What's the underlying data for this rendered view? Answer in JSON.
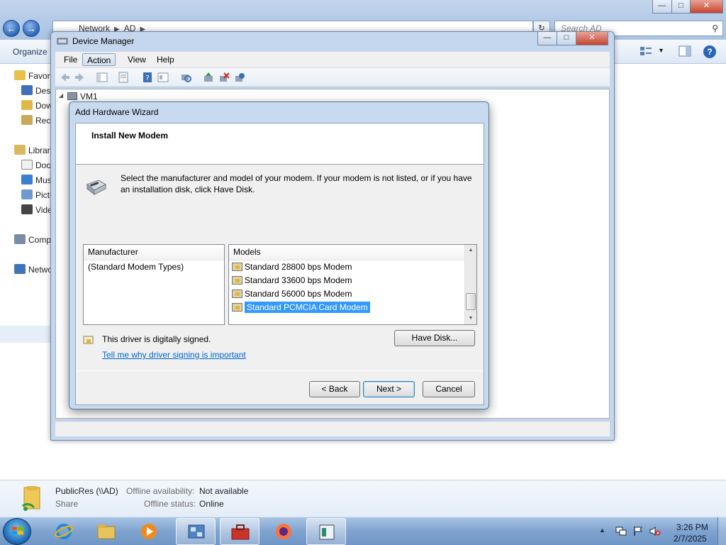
{
  "explorer": {
    "address": [
      "Network",
      "AD"
    ],
    "search_placeholder": "Search AD",
    "organize_label": "Organize",
    "nav": {
      "favorites": "Favorites",
      "desktop": "Desktop",
      "downloads": "Downloads",
      "recent": "Recent Places",
      "libraries": "Libraries",
      "documents": "Documents",
      "music": "Music",
      "pictures": "Pictures",
      "videos": "Videos",
      "computer": "Computer",
      "network": "Network"
    },
    "details": {
      "name": "PublicRes (\\\\AD)",
      "type": "Share",
      "availability_label": "Offline availability:",
      "availability_value": "Not available",
      "status_label": "Offline status:",
      "status_value": "Online"
    }
  },
  "device_manager": {
    "title": "Device Manager",
    "menus": [
      "File",
      "Action",
      "View",
      "Help"
    ],
    "tree_root": "VM1"
  },
  "wizard": {
    "title": "Add Hardware Wizard",
    "heading": "Install New Modem",
    "instructions": "Select the manufacturer and model of your modem. If your modem is not listed, or if you have an installation disk, click Have Disk.",
    "manufacturer_header": "Manufacturer",
    "manufacturers": [
      "(Standard Modem Types)"
    ],
    "models_header": "Models",
    "models": [
      "Standard 28800 bps Modem",
      "Standard 33600 bps Modem",
      "Standard 56000 bps Modem",
      "Standard PCMCIA Card Modem"
    ],
    "selected_model_index": 3,
    "signed_text": "This driver is digitally signed.",
    "signing_link": "Tell me why driver signing is important",
    "have_disk": "Have Disk...",
    "back": "< Back",
    "next": "Next >",
    "cancel": "Cancel"
  },
  "taskbar": {
    "time": "3:26 PM",
    "date": "2/7/2025"
  },
  "colors": {
    "selection": "#3399ff",
    "link": "#0066cc",
    "window_frame": "#c8daf0"
  }
}
